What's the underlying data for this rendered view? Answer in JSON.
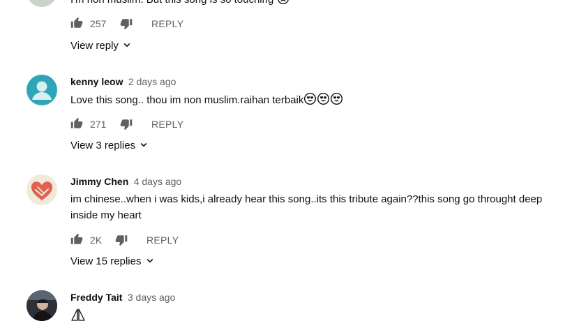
{
  "comments": [
    {
      "text": "I'm non muslim. But this song is so touching",
      "likes": "257",
      "reply_label": "REPLY",
      "view_replies": "View reply"
    },
    {
      "author": "kenny leow",
      "time": "2 days ago",
      "text": "Love this song.. thou im non muslim.raihan terbaik",
      "likes": "271",
      "reply_label": "REPLY",
      "view_replies": "View 3 replies"
    },
    {
      "author": "Jimmy Chen",
      "time": "4 days ago",
      "text_line1": "im chinese..when i was kids,i already hear this song..its this tribute again??this song go throught deep",
      "text_line2": "inside my heart",
      "likes": "2K",
      "reply_label": "REPLY",
      "view_replies": "View 15 replies"
    },
    {
      "author": "Freddy Tait",
      "time": "3 days ago",
      "text": "🙏"
    }
  ],
  "icons": {
    "like": "thumb-up-icon",
    "dislike": "thumb-down-icon",
    "chevron": "chevron-down-icon",
    "emoji_heart_eyes": "heart-eyes-emoji-icon",
    "emoji_sad": "sad-emoji-icon",
    "pray": "pray-icon"
  },
  "colors": {
    "text": "#0f0f0f",
    "secondary": "#606060",
    "avatar_teal": "#2ea6b8",
    "heart_red": "#e0614f"
  }
}
